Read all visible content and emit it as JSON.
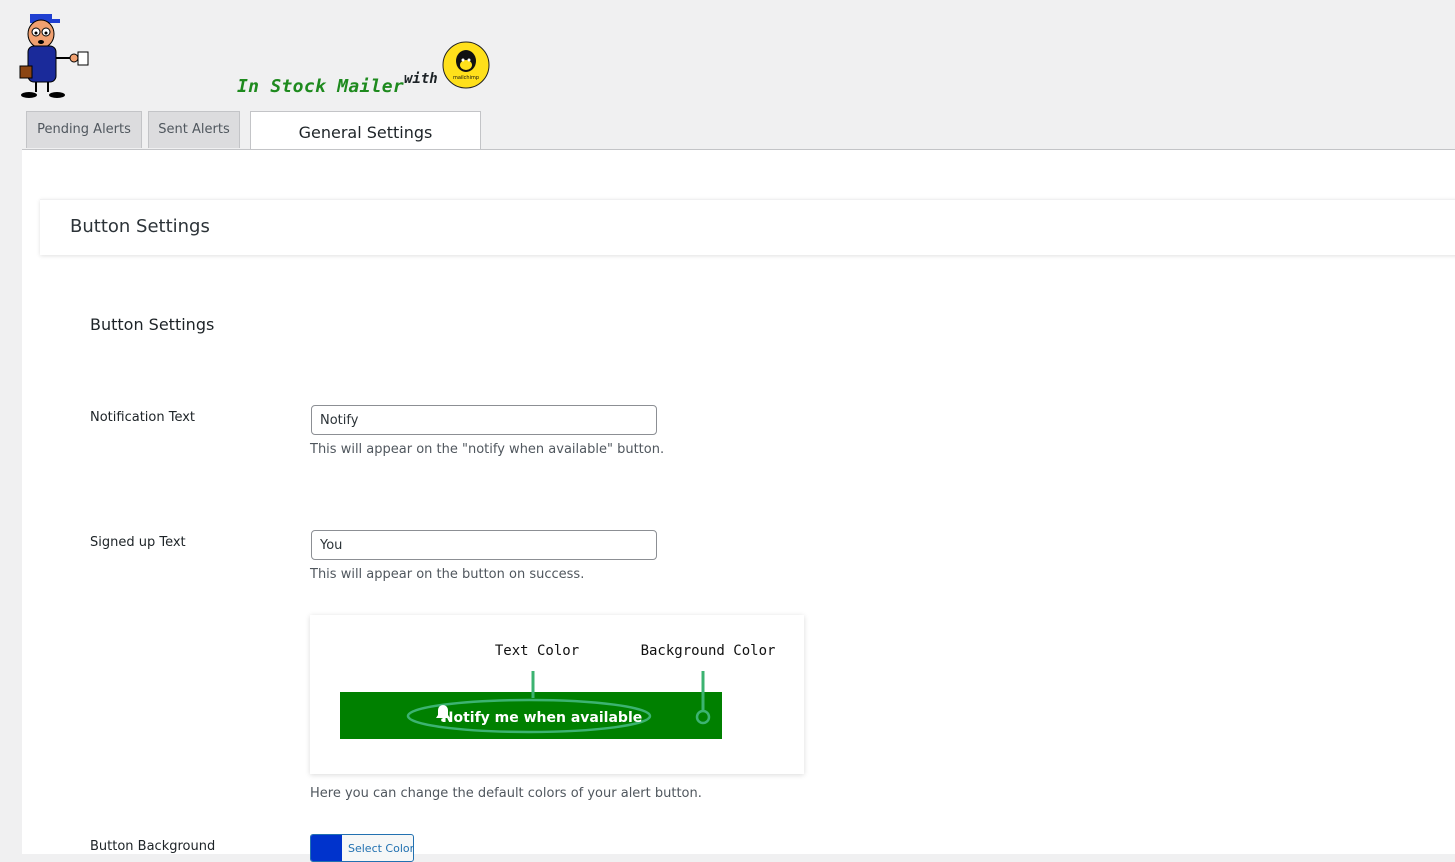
{
  "header": {
    "app_title": "In Stock Mailer",
    "with_label": "with",
    "mailchimp_logo_text": "mailchimp"
  },
  "tabs": [
    {
      "label": "Pending Alerts",
      "active": false
    },
    {
      "label": "Sent Alerts",
      "active": false
    },
    {
      "label": "General Settings",
      "active": true
    }
  ],
  "section": {
    "title": "Button Settings",
    "subtitle": "Button Settings"
  },
  "fields": {
    "notification_text": {
      "label": "Notification Text",
      "value": "Notify",
      "description": "This will appear on the \"notify when available\" button."
    },
    "signed_up_text": {
      "label": "Signed up Text",
      "value": "You",
      "description": "This will appear on the button on success."
    },
    "preview": {
      "text_color_label": "Text Color",
      "background_color_label": "Background Color",
      "button_label": "Notify me when available",
      "button_bg": "#008000",
      "annotation_color": "#3cb371",
      "description": "Here you can change the default colors of your alert button."
    },
    "button_background": {
      "label": "Button Background",
      "picker_label": "Select Color",
      "color": "#0033cc"
    }
  },
  "colors": {
    "page_bg": "#f0f0f1",
    "accent": "#2271b1",
    "title_green": "#1e8a1e",
    "mailchimp_yellow": "#ffe01b"
  }
}
